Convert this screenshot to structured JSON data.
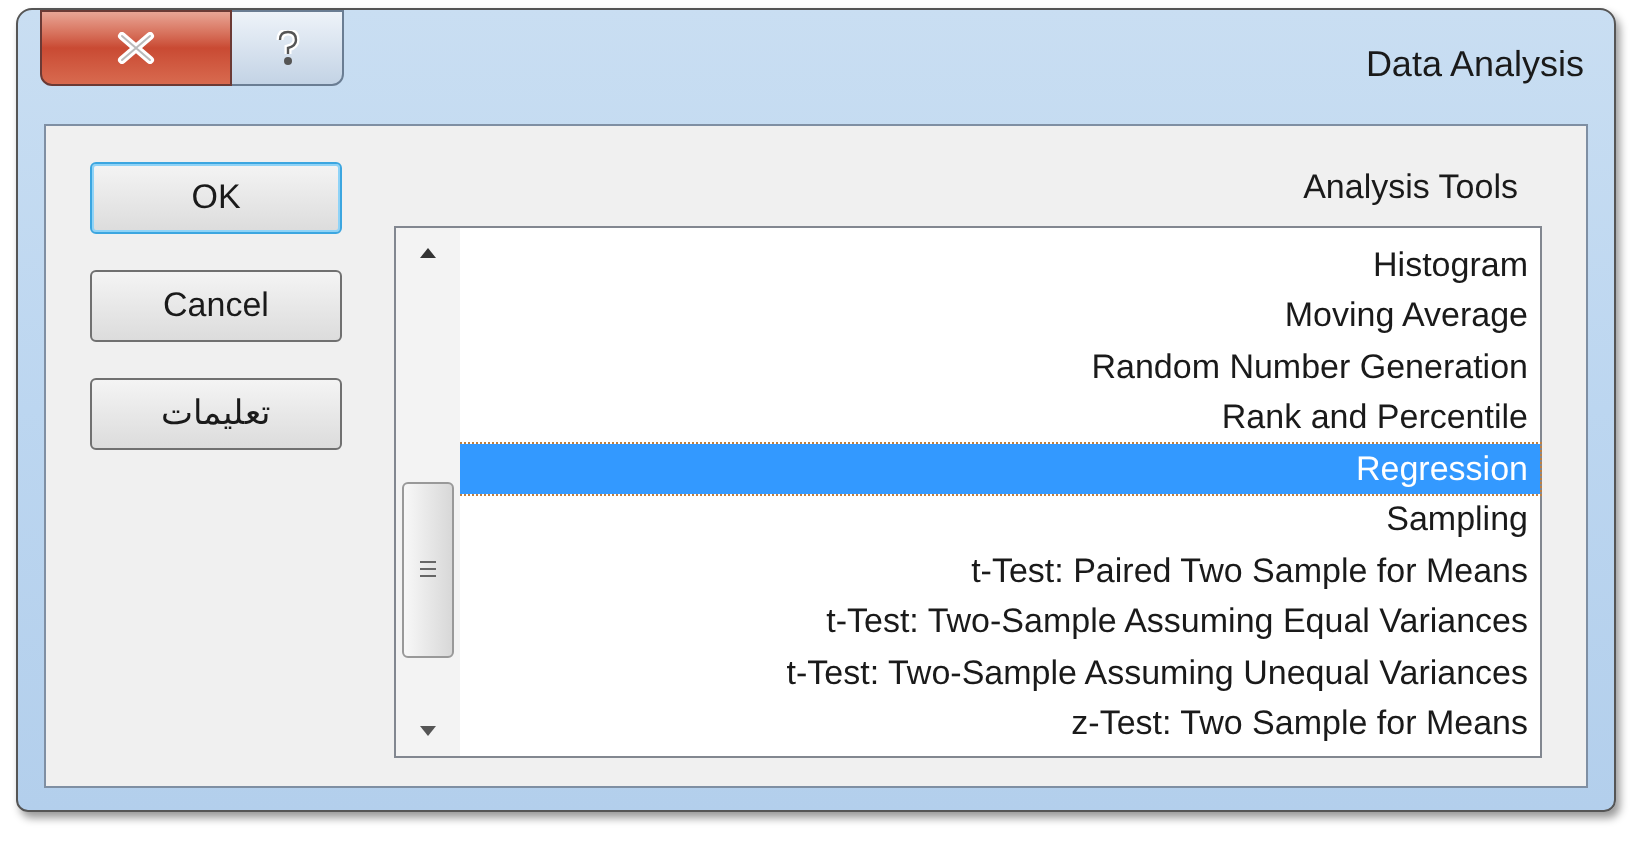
{
  "window": {
    "title": "Data Analysis"
  },
  "buttons": [
    {
      "label": "OK",
      "default": true
    },
    {
      "label": "Cancel",
      "default": false
    },
    {
      "label": "تعليمات",
      "default": false
    }
  ],
  "list": {
    "label": "Analysis Tools",
    "items": [
      {
        "label": "Histogram",
        "selected": false
      },
      {
        "label": "Moving Average",
        "selected": false
      },
      {
        "label": "Random Number Generation",
        "selected": false
      },
      {
        "label": "Rank and Percentile",
        "selected": false
      },
      {
        "label": "Regression",
        "selected": true
      },
      {
        "label": "Sampling",
        "selected": false
      },
      {
        "label": "t-Test: Paired Two Sample for Means",
        "selected": false
      },
      {
        "label": "t-Test: Two-Sample Assuming Equal Variances",
        "selected": false
      },
      {
        "label": "t-Test: Two-Sample Assuming Unequal Variances",
        "selected": false
      },
      {
        "label": "z-Test: Two Sample for Means",
        "selected": false
      }
    ]
  }
}
